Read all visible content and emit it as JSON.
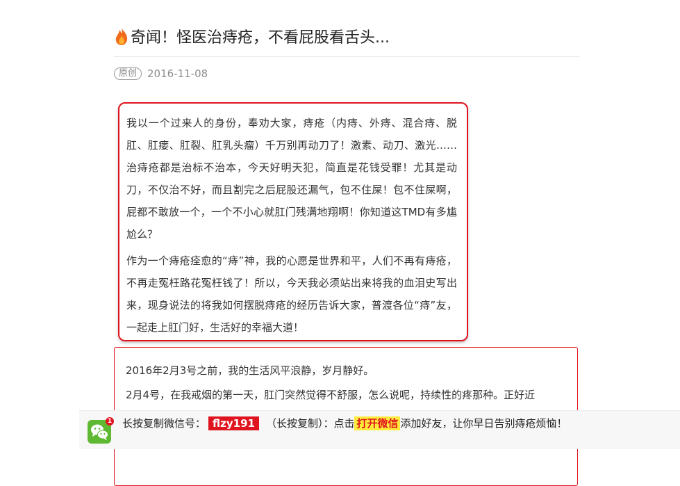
{
  "article": {
    "title": "奇闻！怪医治痔疮，不看屁股看舌头...",
    "tag": "原创",
    "date": "2016-11-08",
    "intro_paragraphs": [
      "我以一个过来人的身份，奉劝大家，痔疮（内痔、外痔、混合痔、脱肛、肛瘘、肛裂、肛乳头瘤）千万别再动刀了！激素、动刀、激光……治痔疮都是治标不治本，今天好明天犯，简直是花钱受罪！尤其是动刀，不仅治不好，而且割完之后屁股还漏气，包不住屎！包不住屎啊，屁都不敢放一个，一个不小心就肛门残满地翔啊！你知道这TMD有多尴尬么？",
      "作为一个痔疮痊愈的“痔”神，我的心愿是世界和平，人们不再有痔疮，不再走冤枉路花冤枉钱了！所以，今天我必须站出来将我的血泪史写出来，现身说法的将我如何摆脱痔疮的经历告诉大家，普渡各位“痔”友，一起走上肛门好，生活好的幸福大道！"
    ],
    "story_paragraphs": [
      "2016年2月3号之前，我的生活风平浪静，岁月静好。",
      "2月4号，在我戒烟的第一天，肛门突然觉得不舒服，怎么说呢，持续性的疼那种。正好近"
    ]
  },
  "bottom_bar": {
    "badge_count": "1",
    "prefix": "长按复制微信号：",
    "wechat_id": "flzy191",
    "copy_hint": "（长按复制）：点击",
    "open_button": "打开微信",
    "suffix": "添加好友，让你早日告别痔疮烦恼！"
  },
  "colors": {
    "accent_red": "#e0141e",
    "highlight_yellow": "#ffeb3b",
    "wechat_green": "#5fb832"
  },
  "icons": {
    "title_icon": "flame-icon",
    "bar_icon": "wechat-icon"
  }
}
